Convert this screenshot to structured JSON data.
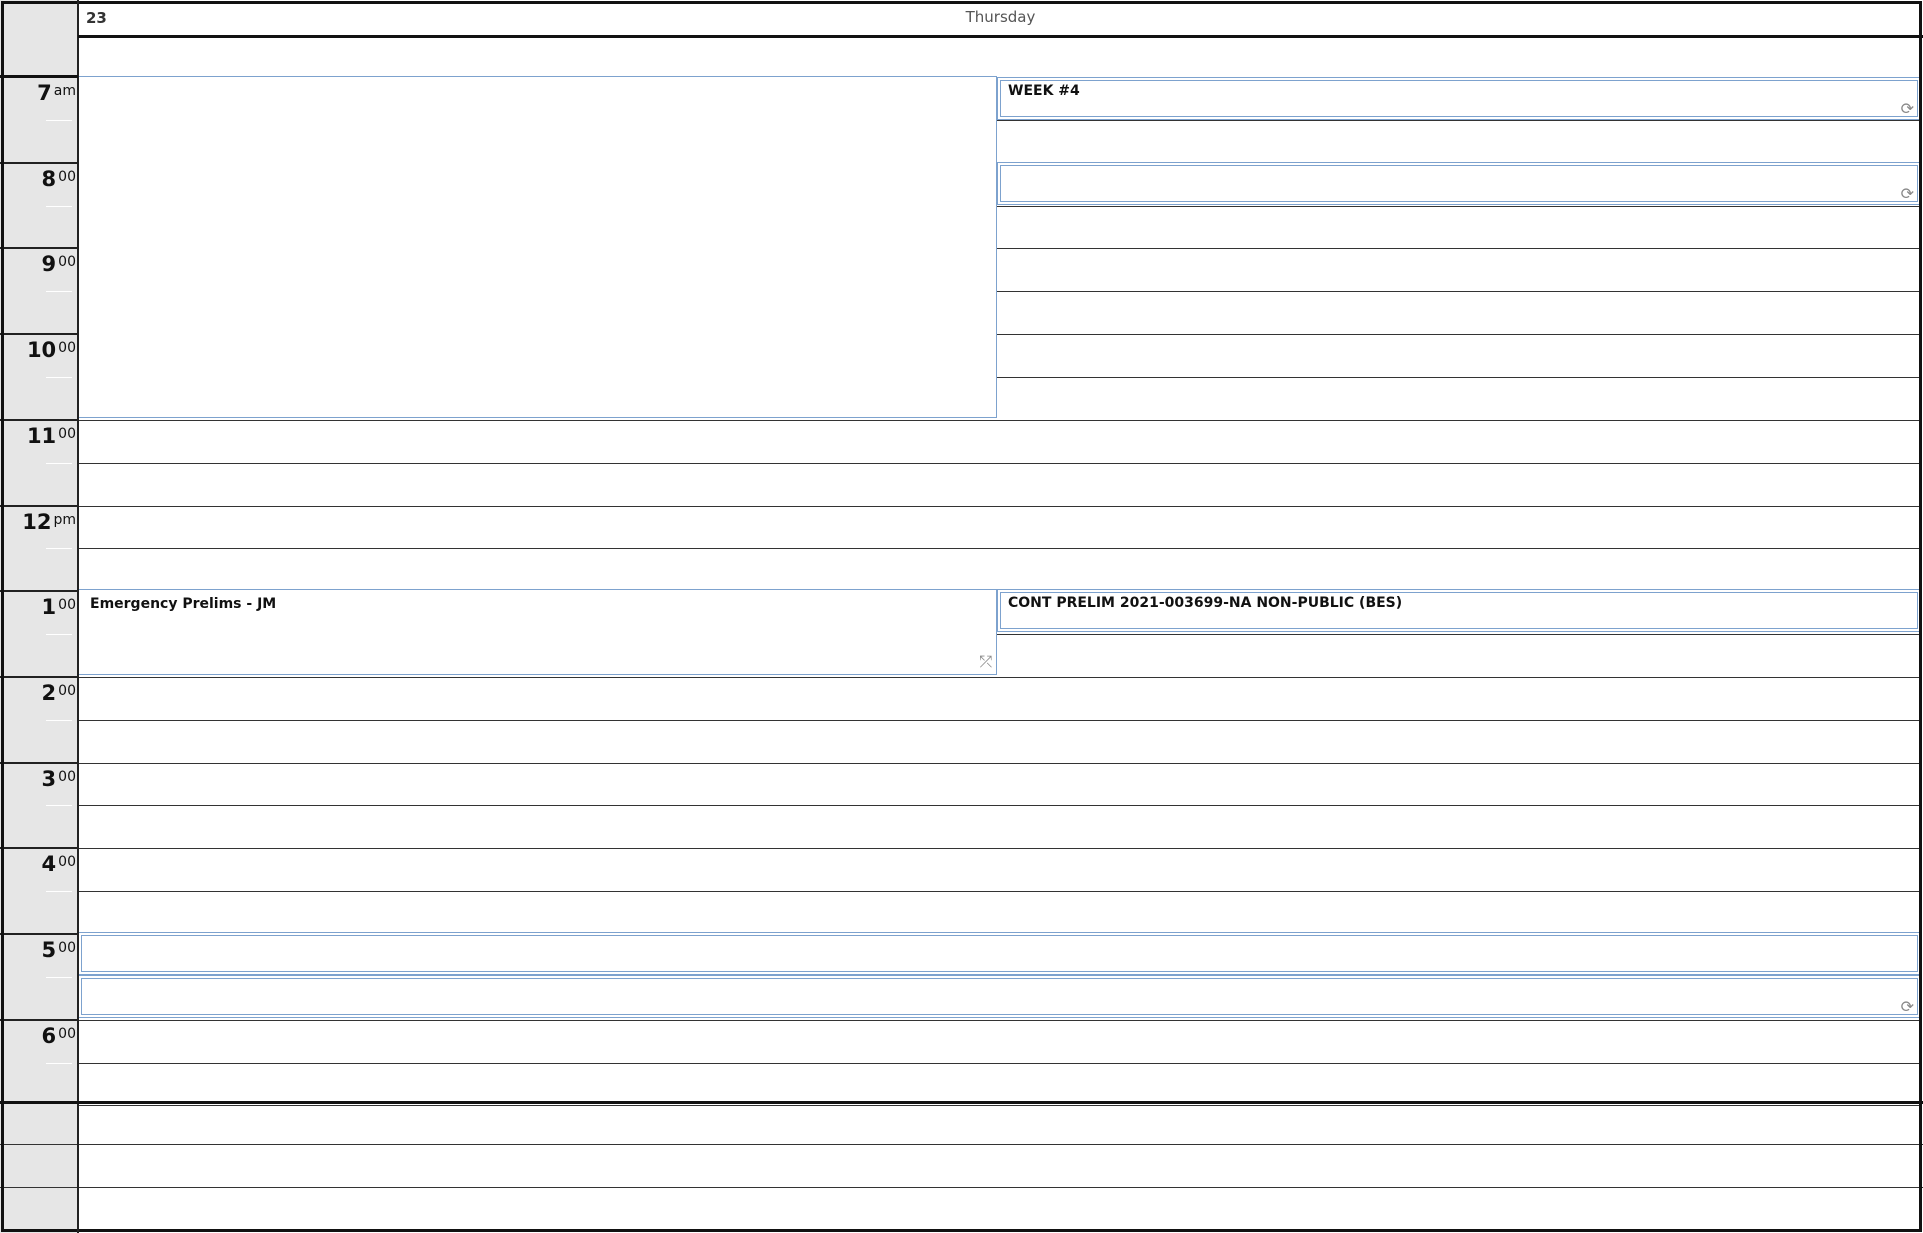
{
  "header": {
    "day_number": "23",
    "day_name": "Thursday"
  },
  "hours": [
    {
      "hour": "7",
      "suffix": "am"
    },
    {
      "hour": "8",
      "suffix": "00"
    },
    {
      "hour": "9",
      "suffix": "00"
    },
    {
      "hour": "10",
      "suffix": "00"
    },
    {
      "hour": "11",
      "suffix": "00"
    },
    {
      "hour": "12",
      "suffix": "pm"
    },
    {
      "hour": "1",
      "suffix": "00"
    },
    {
      "hour": "2",
      "suffix": "00"
    },
    {
      "hour": "3",
      "suffix": "00"
    },
    {
      "hour": "4",
      "suffix": "00"
    },
    {
      "hour": "5",
      "suffix": "00"
    },
    {
      "hour": "6",
      "suffix": "00"
    }
  ],
  "events": {
    "week4": {
      "title": "WEEK #4",
      "icon": "recurring-icon"
    },
    "untitled_8am": {
      "title": "",
      "icon": "recurring-icon"
    },
    "emergency": {
      "title": "Emergency Prelims - JM",
      "icon": "recurring-exception-icon"
    },
    "cont_prelim": {
      "title": "CONT PRELIM 2021-003699-NA NON-PUBLIC (BES)"
    },
    "evening": {
      "title": "",
      "icon": "recurring-icon"
    }
  },
  "colors": {
    "event_border": "#7da2ce",
    "gutter": "#e6e6e6",
    "grid_line": "#333333"
  }
}
